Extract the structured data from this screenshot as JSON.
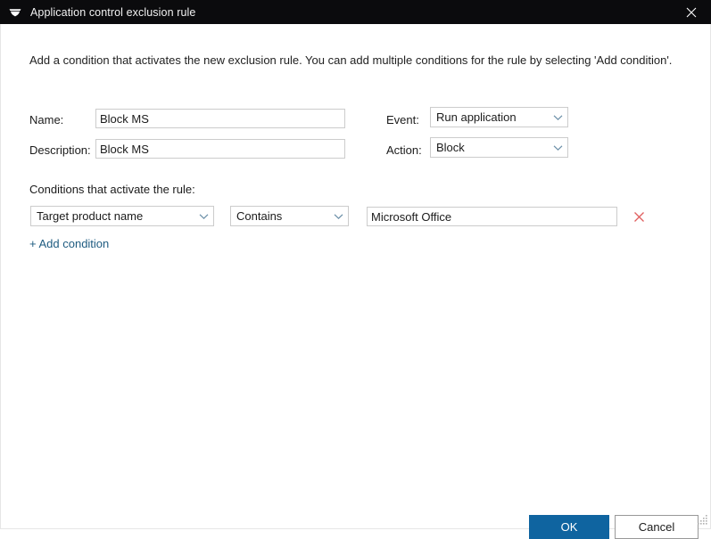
{
  "window": {
    "title": "Application control exclusion rule",
    "app_icon": "f-secure-shield-icon",
    "close_icon": "close-icon"
  },
  "intro": {
    "text": "Add a condition that activates the new exclusion rule. You can add multiple conditions for the rule by selecting 'Add condition'."
  },
  "form": {
    "name_label": "Name:",
    "name_value": "Block MS",
    "name_placeholder": "",
    "description_label": "Description:",
    "description_value": "Block MS",
    "description_placeholder": "",
    "event_label": "Event:",
    "event_value": "Run application",
    "action_label": "Action:",
    "action_value": "Block"
  },
  "conditions": {
    "section_label": "Conditions that activate the rule:",
    "rows": [
      {
        "attribute": "Target product name",
        "operator": "Contains",
        "value": "Microsoft Office",
        "value_placeholder": "",
        "remove_icon": "remove-x-icon"
      }
    ],
    "add_label": "+ Add condition"
  },
  "footer": {
    "ok_label": "OK",
    "cancel_label": "Cancel"
  },
  "colors": {
    "titlebar_bg": "#0b0b0d",
    "primary_button": "#0f64a0",
    "link": "#1e5b80",
    "remove_x": "#e06060",
    "field_border": "#cccccc"
  }
}
